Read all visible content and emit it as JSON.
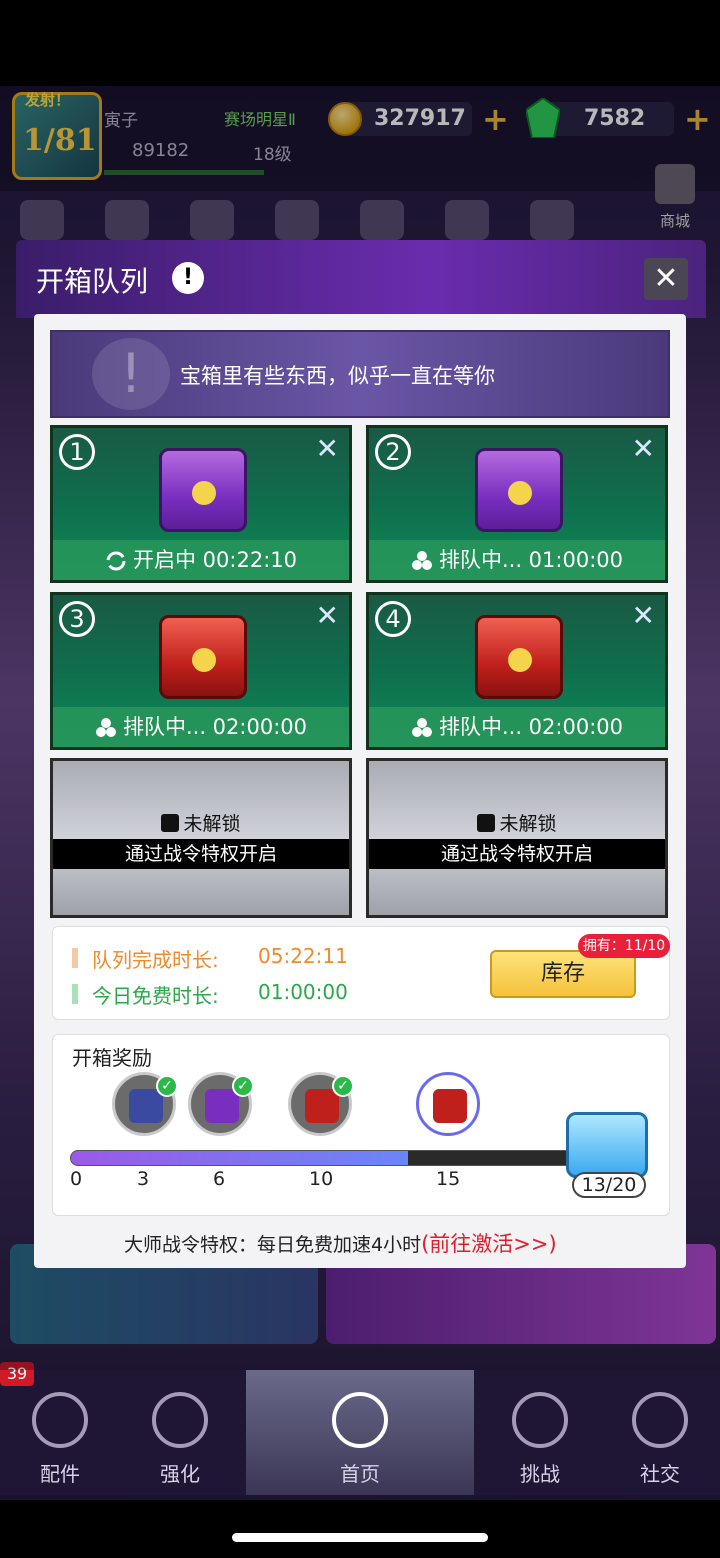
{
  "header": {
    "rank_tag": "发射！",
    "rank_value": "1/81",
    "player_name": "寅子",
    "player_title": "赛场明星Ⅱ",
    "exp_value": "89182",
    "level": "18级",
    "coins": "327917",
    "gems": "7582",
    "shop_label": "商城"
  },
  "modal": {
    "title": "开箱队列",
    "close_symbol": "✕",
    "info_symbol": "!",
    "banner_text": "宝箱里有些东西，似乎一直在等你",
    "slots": [
      {
        "number": "1",
        "chest": "purple",
        "status": "开启中 00:22:10",
        "status_icon": "refresh-icon",
        "remove": "✕"
      },
      {
        "number": "2",
        "chest": "purple",
        "status": "排队中...  01:00:00",
        "status_icon": "queue-icon",
        "remove": "✕"
      },
      {
        "number": "3",
        "chest": "red",
        "status": "排队中...  02:00:00",
        "status_icon": "queue-icon",
        "remove": "✕"
      },
      {
        "number": "4",
        "chest": "red",
        "status": "排队中...  02:00:00",
        "status_icon": "queue-icon",
        "remove": "✕"
      }
    ],
    "locked_slots": [
      {
        "label": "未解锁",
        "hint": "通过战令特权开启"
      },
      {
        "label": "未解锁",
        "hint": "通过战令特权开启"
      }
    ],
    "queue_time_label": "队列完成时长:",
    "queue_time_value": "05:22:11",
    "free_time_label": "今日免费时长:",
    "free_time_value": "01:00:00",
    "inventory_button": "库存",
    "inventory_badge": "拥有：11/10",
    "rewards_title": "开箱奖励",
    "reward_ticks": [
      "0",
      "3",
      "6",
      "10",
      "15"
    ],
    "reward_progress": 0.65,
    "reward_count": "13/20",
    "footer_text": "大师战令特权：每日免费加速4小时",
    "footer_link": "(前往激活>>)"
  },
  "bottom_nav": {
    "badge": "39",
    "items": [
      "配件",
      "强化",
      "首页",
      "挑战",
      "社交"
    ],
    "active": "首页"
  },
  "colors": {
    "accent_purple": "#6a2cae",
    "slot_green": "#0f6e4d",
    "queue_time_orange": "#f08a2a",
    "free_time_green": "#2aa84a",
    "link_red": "#e01e2a"
  }
}
